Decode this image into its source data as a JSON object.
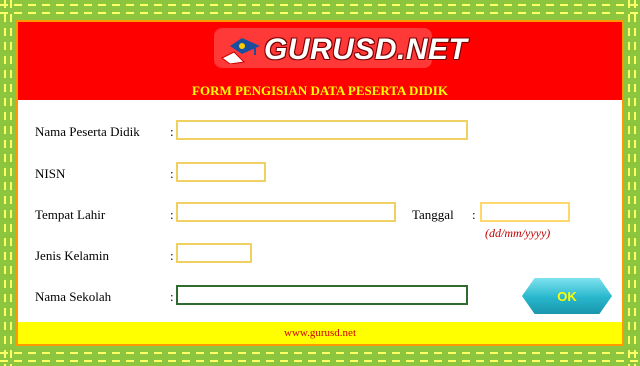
{
  "logo": {
    "text": "GURUSD.NET"
  },
  "form": {
    "title": "FORM PENGISIAN DATA PESERTA DIDIK",
    "colon": ":",
    "fields": {
      "nama_peserta_didik": {
        "label": "Nama Peserta Didik",
        "value": ""
      },
      "nisn": {
        "label": "NISN",
        "value": ""
      },
      "tempat_lahir": {
        "label": "Tempat Lahir",
        "value": ""
      },
      "tanggal": {
        "label": "Tanggal",
        "value": "",
        "hint": "(dd/mm/yyyy)"
      },
      "jenis_kelamin": {
        "label": "Jenis Kelamin",
        "value": ""
      },
      "nama_sekolah": {
        "label": "Nama Sekolah",
        "value": ""
      }
    },
    "ok_button": "OK"
  },
  "footer": {
    "text": "www.gurusd.net"
  },
  "colors": {
    "header": "#ff0000",
    "title": "#ffff00",
    "frame": "#8cc63f",
    "button": "#27b6cc",
    "hint": "#c00000"
  }
}
